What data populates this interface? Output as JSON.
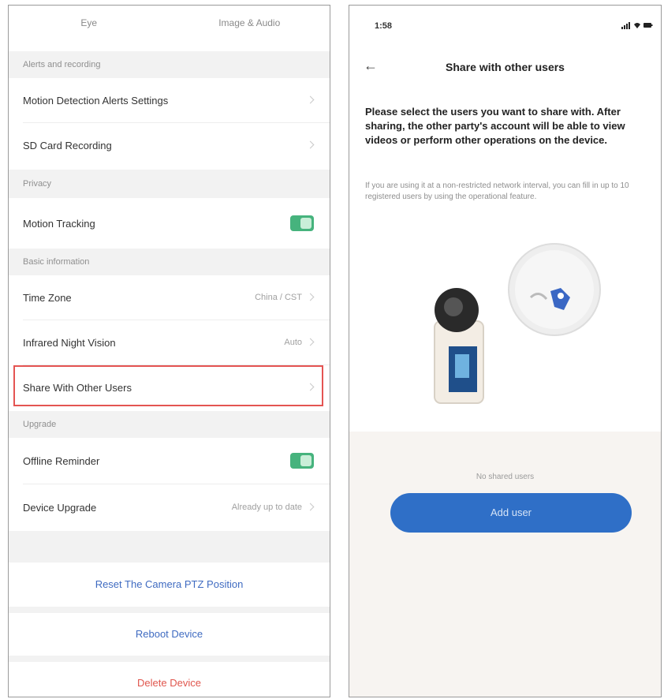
{
  "left_screen": {
    "tabs": [
      "Eye",
      "Image & Audio"
    ],
    "sections": [
      {
        "header": "Alerts and recording",
        "rows": [
          {
            "label": "Motion Detection Alerts Settings",
            "value": ""
          },
          {
            "label": "SD Card Recording",
            "value": ""
          }
        ]
      },
      {
        "header": "Privacy",
        "rows": [
          {
            "label": "Motion Tracking",
            "value": "",
            "toggle": true
          }
        ]
      },
      {
        "header": "Basic information",
        "rows": [
          {
            "label": "Time Zone",
            "value": "China / CST"
          },
          {
            "label": "Infrared Night Vision",
            "value": "Auto"
          },
          {
            "label": "Share With Other Users",
            "value": "",
            "highlighted": true
          }
        ]
      },
      {
        "header": "Upgrade",
        "rows": [
          {
            "label": "Offline Reminder",
            "value": "",
            "toggle": true
          },
          {
            "label": "Device Upgrade",
            "value": "Already up to date"
          }
        ]
      }
    ],
    "actions": [
      {
        "label": "Reset The Camera PTZ Position",
        "color": "#3f6bc1"
      },
      {
        "label": "Reboot Device",
        "color": "#3f6bc1"
      },
      {
        "label": "Delete Device",
        "color": "#e0564d"
      }
    ],
    "colors": {
      "highlight": "#e45452",
      "toggle": "#46b37d"
    }
  },
  "right_screen": {
    "status_bar": {
      "time": "1:58",
      "icons": "signal-wifi-battery"
    },
    "nav": {
      "back_icon": "back-arrow-icon",
      "title": "Share with other users"
    },
    "headline": "Please select the users you want to share with. After sharing, the other party's account will be able to view videos or perform other operations on the device.",
    "subtext": "If you are using it at a non-restricted network interval, you can fill in up to 10 registered users by using the operational feature.",
    "illustration": "camera-share-illustration",
    "bottom_note": "No shared users",
    "add_button": "Add user",
    "colors": {
      "button": "#2f6fc7",
      "bottom_bg": "#f7f4f1"
    }
  }
}
